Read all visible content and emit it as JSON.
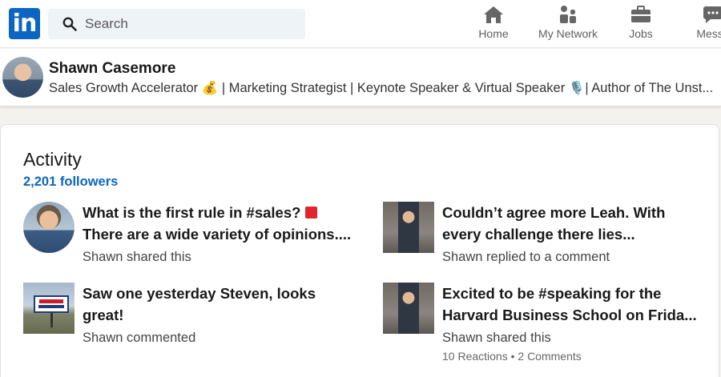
{
  "nav": {
    "logo_text": "in",
    "search_placeholder": "Search",
    "items": [
      {
        "label": "Home",
        "icon": "home-icon"
      },
      {
        "label": "My Network",
        "icon": "people-icon"
      },
      {
        "label": "Jobs",
        "icon": "briefcase-icon"
      },
      {
        "label": "Messa",
        "icon": "messaging-icon"
      }
    ]
  },
  "profile": {
    "name": "Shawn Casemore",
    "headline": "Sales Growth Accelerator 💰 | Marketing Strategist | Keynote Speaker & Virtual Speaker 🎙️| Author of The Unst..."
  },
  "activity": {
    "title": "Activity",
    "followers": "2,201 followers",
    "posts": [
      {
        "line1": "What is the first rule in #sales? ",
        "line2": "There are a wide variety of opinions....",
        "meta": "Shawn shared this",
        "stats": ""
      },
      {
        "line1": "Couldn’t agree more Leah. With",
        "line2": "every challenge there lies...",
        "meta": "Shawn replied to a comment",
        "stats": ""
      },
      {
        "line1": "Saw one yesterday Steven, looks",
        "line2": "great!",
        "meta": "Shawn commented",
        "stats": ""
      },
      {
        "line1": "Excited to be #speaking for the",
        "line2": "Harvard Business School on Frida...",
        "meta": "Shawn shared this",
        "stats": "10 Reactions • 2 Comments"
      }
    ]
  },
  "colors": {
    "brand": "#0a66c2",
    "flag": "#e0262c"
  }
}
